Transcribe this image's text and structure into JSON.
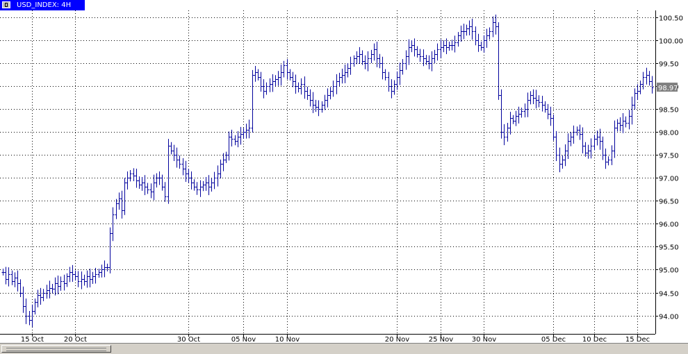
{
  "window": {
    "title": "USD_INDEX: 4H",
    "chart_icon": "chart-window-icon"
  },
  "colors": {
    "background": "#ffffff",
    "bars": "#00009c",
    "grid": "#000000",
    "title_bg": "#0000ff",
    "price_badge_bg": "#808080",
    "price_badge_text": "#ffffff"
  },
  "chart_data": {
    "type": "ohlc",
    "symbol": "USD_INDEX",
    "timeframe": "4H",
    "title": "USD_INDEX: 4H",
    "current_price_label": "98.97",
    "ylim": [
      93.6,
      100.65
    ],
    "y_ticks": [
      "100.50",
      "100.00",
      "99.50",
      "99.00",
      "98.50",
      "98.00",
      "97.50",
      "97.00",
      "96.50",
      "96.00",
      "95.50",
      "95.00",
      "94.50",
      "94.00"
    ],
    "x_ticks": [
      "15 Oct",
      "20 Oct",
      "30 Oct",
      "05 Nov",
      "10 Nov",
      "20 Nov",
      "25 Nov",
      "30 Nov",
      "05 Dec",
      "10 Dec",
      "15 Dec"
    ],
    "x_tick_bar_index": [
      10,
      25,
      64,
      83,
      98,
      136,
      151,
      166,
      190,
      204,
      219
    ],
    "grid": "dotted",
    "bar_count": 236,
    "close_series": [
      94.95,
      94.8,
      94.9,
      94.75,
      94.82,
      94.7,
      94.5,
      94.2,
      94.0,
      93.9,
      94.1,
      94.3,
      94.45,
      94.4,
      94.5,
      94.55,
      94.6,
      94.58,
      94.7,
      94.65,
      94.75,
      94.7,
      94.85,
      94.95,
      94.9,
      94.85,
      94.75,
      94.8,
      94.75,
      94.85,
      94.8,
      94.85,
      94.9,
      94.95,
      95.0,
      95.05,
      95.05,
      95.8,
      96.2,
      96.45,
      96.55,
      96.3,
      96.9,
      97.0,
      97.1,
      97.05,
      96.95,
      96.85,
      96.9,
      96.8,
      96.75,
      96.7,
      96.9,
      97.0,
      97.0,
      96.8,
      96.6,
      97.7,
      97.6,
      97.5,
      97.4,
      97.3,
      97.2,
      97.1,
      97.0,
      96.9,
      96.8,
      96.75,
      96.8,
      96.85,
      96.9,
      96.8,
      96.9,
      97.0,
      97.1,
      97.3,
      97.4,
      97.5,
      97.9,
      97.85,
      97.8,
      97.9,
      97.95,
      98.0,
      98.05,
      98.1,
      99.25,
      99.3,
      99.2,
      99.0,
      98.9,
      99.0,
      99.05,
      99.1,
      99.15,
      99.2,
      99.3,
      99.45,
      99.3,
      99.2,
      99.1,
      99.0,
      98.95,
      99.05,
      98.9,
      98.8,
      98.7,
      98.6,
      98.55,
      98.5,
      98.6,
      98.7,
      98.8,
      98.9,
      99.0,
      99.1,
      99.2,
      99.25,
      99.3,
      99.4,
      99.5,
      99.6,
      99.65,
      99.7,
      99.55,
      99.5,
      99.6,
      99.7,
      99.8,
      99.6,
      99.5,
      99.3,
      99.2,
      99.0,
      98.9,
      99.05,
      99.2,
      99.35,
      99.5,
      99.65,
      99.85,
      99.9,
      99.8,
      99.7,
      99.65,
      99.6,
      99.55,
      99.5,
      99.6,
      99.7,
      99.8,
      99.85,
      99.9,
      99.85,
      99.9,
      99.9,
      99.95,
      100.1,
      100.2,
      100.2,
      100.25,
      100.3,
      100.2,
      100.0,
      99.9,
      99.85,
      100.0,
      100.1,
      100.2,
      100.4,
      100.3,
      98.8,
      98.0,
      97.9,
      98.1,
      98.3,
      98.25,
      98.35,
      98.4,
      98.45,
      98.5,
      98.7,
      98.8,
      98.75,
      98.7,
      98.65,
      98.6,
      98.5,
      98.4,
      98.3,
      97.9,
      97.5,
      97.3,
      97.4,
      97.6,
      97.8,
      97.9,
      98.0,
      98.05,
      97.95,
      97.7,
      97.55,
      97.6,
      97.7,
      97.85,
      97.9,
      97.8,
      97.5,
      97.35,
      97.4,
      97.6,
      98.1,
      98.2,
      98.15,
      98.25,
      98.2,
      98.35,
      98.6,
      98.85,
      98.9,
      99.05,
      99.2,
      99.25,
      99.1,
      98.97
    ]
  }
}
